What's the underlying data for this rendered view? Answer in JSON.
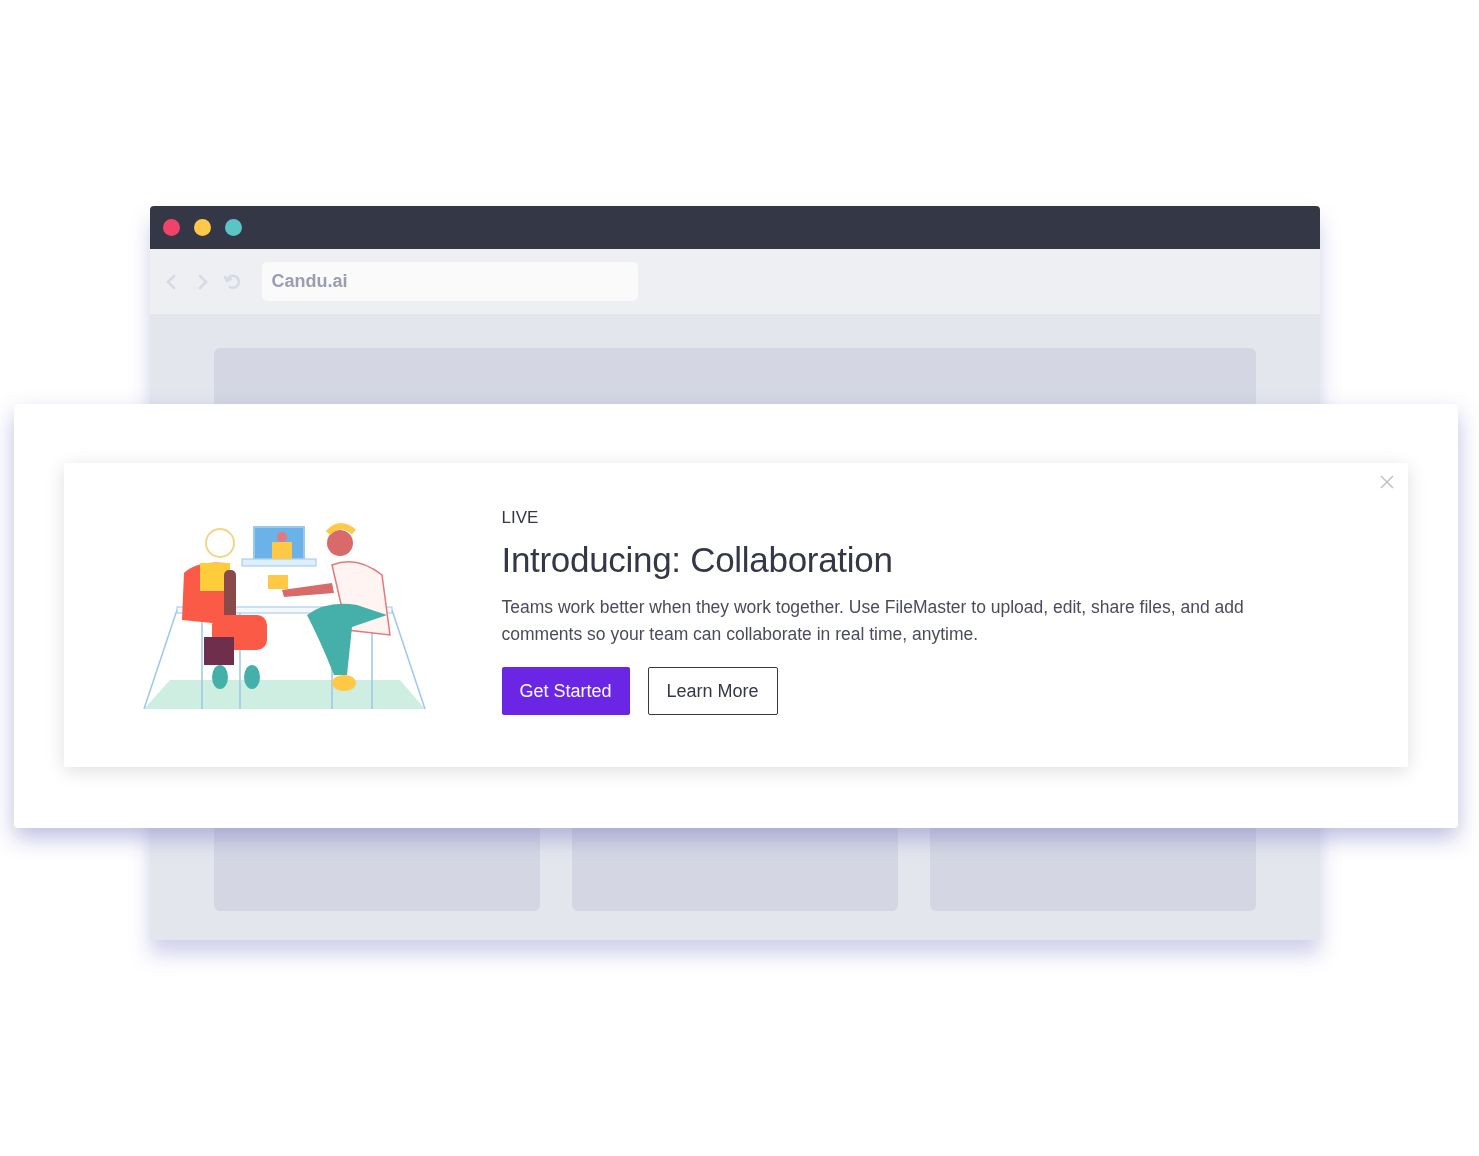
{
  "browser": {
    "window_controls": [
      {
        "color": "#f0436a"
      },
      {
        "color": "#ffc84a"
      },
      {
        "color": "#5bc4c4"
      }
    ],
    "address": "Candu.ai"
  },
  "announcement": {
    "badge": "LIVE",
    "title": "Introducing: Collaboration",
    "body": "Teams work better when they work together. Use FileMaster to upload, edit, share files, and add comments so your team can collaborate in real time, anytime.",
    "buttons": [
      {
        "label": "Get Started",
        "kind": "primary"
      },
      {
        "label": "Learn More",
        "kind": "secondary"
      }
    ]
  }
}
